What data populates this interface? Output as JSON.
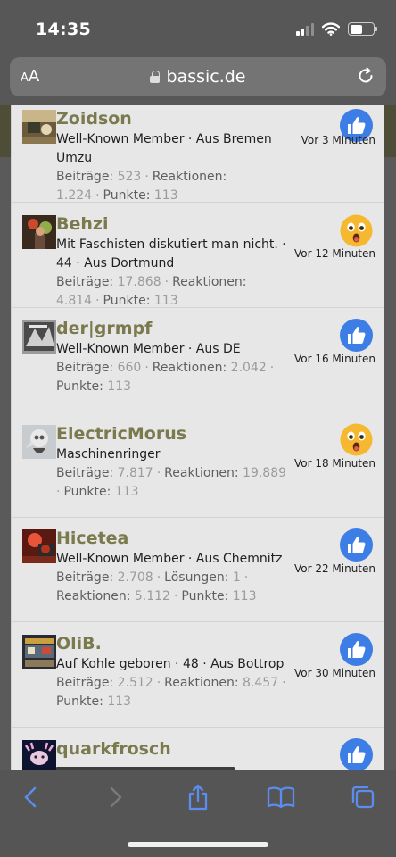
{
  "status": {
    "time": "14:35"
  },
  "browser": {
    "aa_small": "A",
    "aa_big": "A",
    "url": "bassic.de"
  },
  "reactions": [
    {
      "name": "Zoidson",
      "title": "Well-Known Member · Aus Bremen Umzu",
      "stats": [
        {
          "label": "Beiträge:",
          "value": "523"
        },
        {
          "label": "Reaktionen:",
          "value": "1.224"
        },
        {
          "label": "Punkte:",
          "value": "113"
        }
      ],
      "reaction": "like-icon",
      "time": "Vor 3 Minuten"
    },
    {
      "name": "Behzi",
      "title": "Mit Faschisten diskutiert man nicht. · 44 · Aus Dortmund",
      "stats": [
        {
          "label": "Beiträge:",
          "value": "17.868"
        },
        {
          "label": "Reaktionen:",
          "value": "4.814"
        },
        {
          "label": "Punkte:",
          "value": "113"
        }
      ],
      "reaction": "wow-icon",
      "time": "Vor 12 Minuten"
    },
    {
      "name": "der|grmpf",
      "title": "Well-Known Member · Aus DE",
      "stats": [
        {
          "label": "Beiträge:",
          "value": "660"
        },
        {
          "label": "Reaktionen:",
          "value": "2.042"
        },
        {
          "label": "Punkte:",
          "value": "113"
        }
      ],
      "reaction": "like-icon",
      "time": "Vor 16 Minuten"
    },
    {
      "name": "ElectricMorus",
      "title": "Maschinenringer",
      "stats": [
        {
          "label": "Beiträge:",
          "value": "7.817"
        },
        {
          "label": "Reaktionen:",
          "value": "19.889"
        },
        {
          "label": "Punkte:",
          "value": "113"
        }
      ],
      "reaction": "wow-icon",
      "time": "Vor 18 Minuten"
    },
    {
      "name": "Hicetea",
      "title": "Well-Known Member · Aus Chemnitz",
      "stats": [
        {
          "label": "Beiträge:",
          "value": "2.708"
        },
        {
          "label": "Lösungen:",
          "value": "1"
        },
        {
          "label": "Reaktionen:",
          "value": "5.112"
        },
        {
          "label": "Punkte:",
          "value": "113"
        }
      ],
      "reaction": "like-icon",
      "time": "Vor 22 Minuten"
    },
    {
      "name": "OliB.",
      "title": "Auf Kohle geboren · 48 · Aus Bottrop",
      "stats": [
        {
          "label": "Beiträge:",
          "value": "2.512"
        },
        {
          "label": "Reaktionen:",
          "value": "8.457"
        },
        {
          "label": "Punkte:",
          "value": "113"
        }
      ],
      "reaction": "like-icon",
      "time": "Vor 30 Minuten"
    },
    {
      "name": "quarkfrosch",
      "title": "",
      "stats": [],
      "reaction": "like-icon",
      "time": ""
    }
  ],
  "colors": {
    "username": "#7a7a4e",
    "like_blue": "#3d7de6",
    "wow_yellow": "#f5b82e"
  }
}
